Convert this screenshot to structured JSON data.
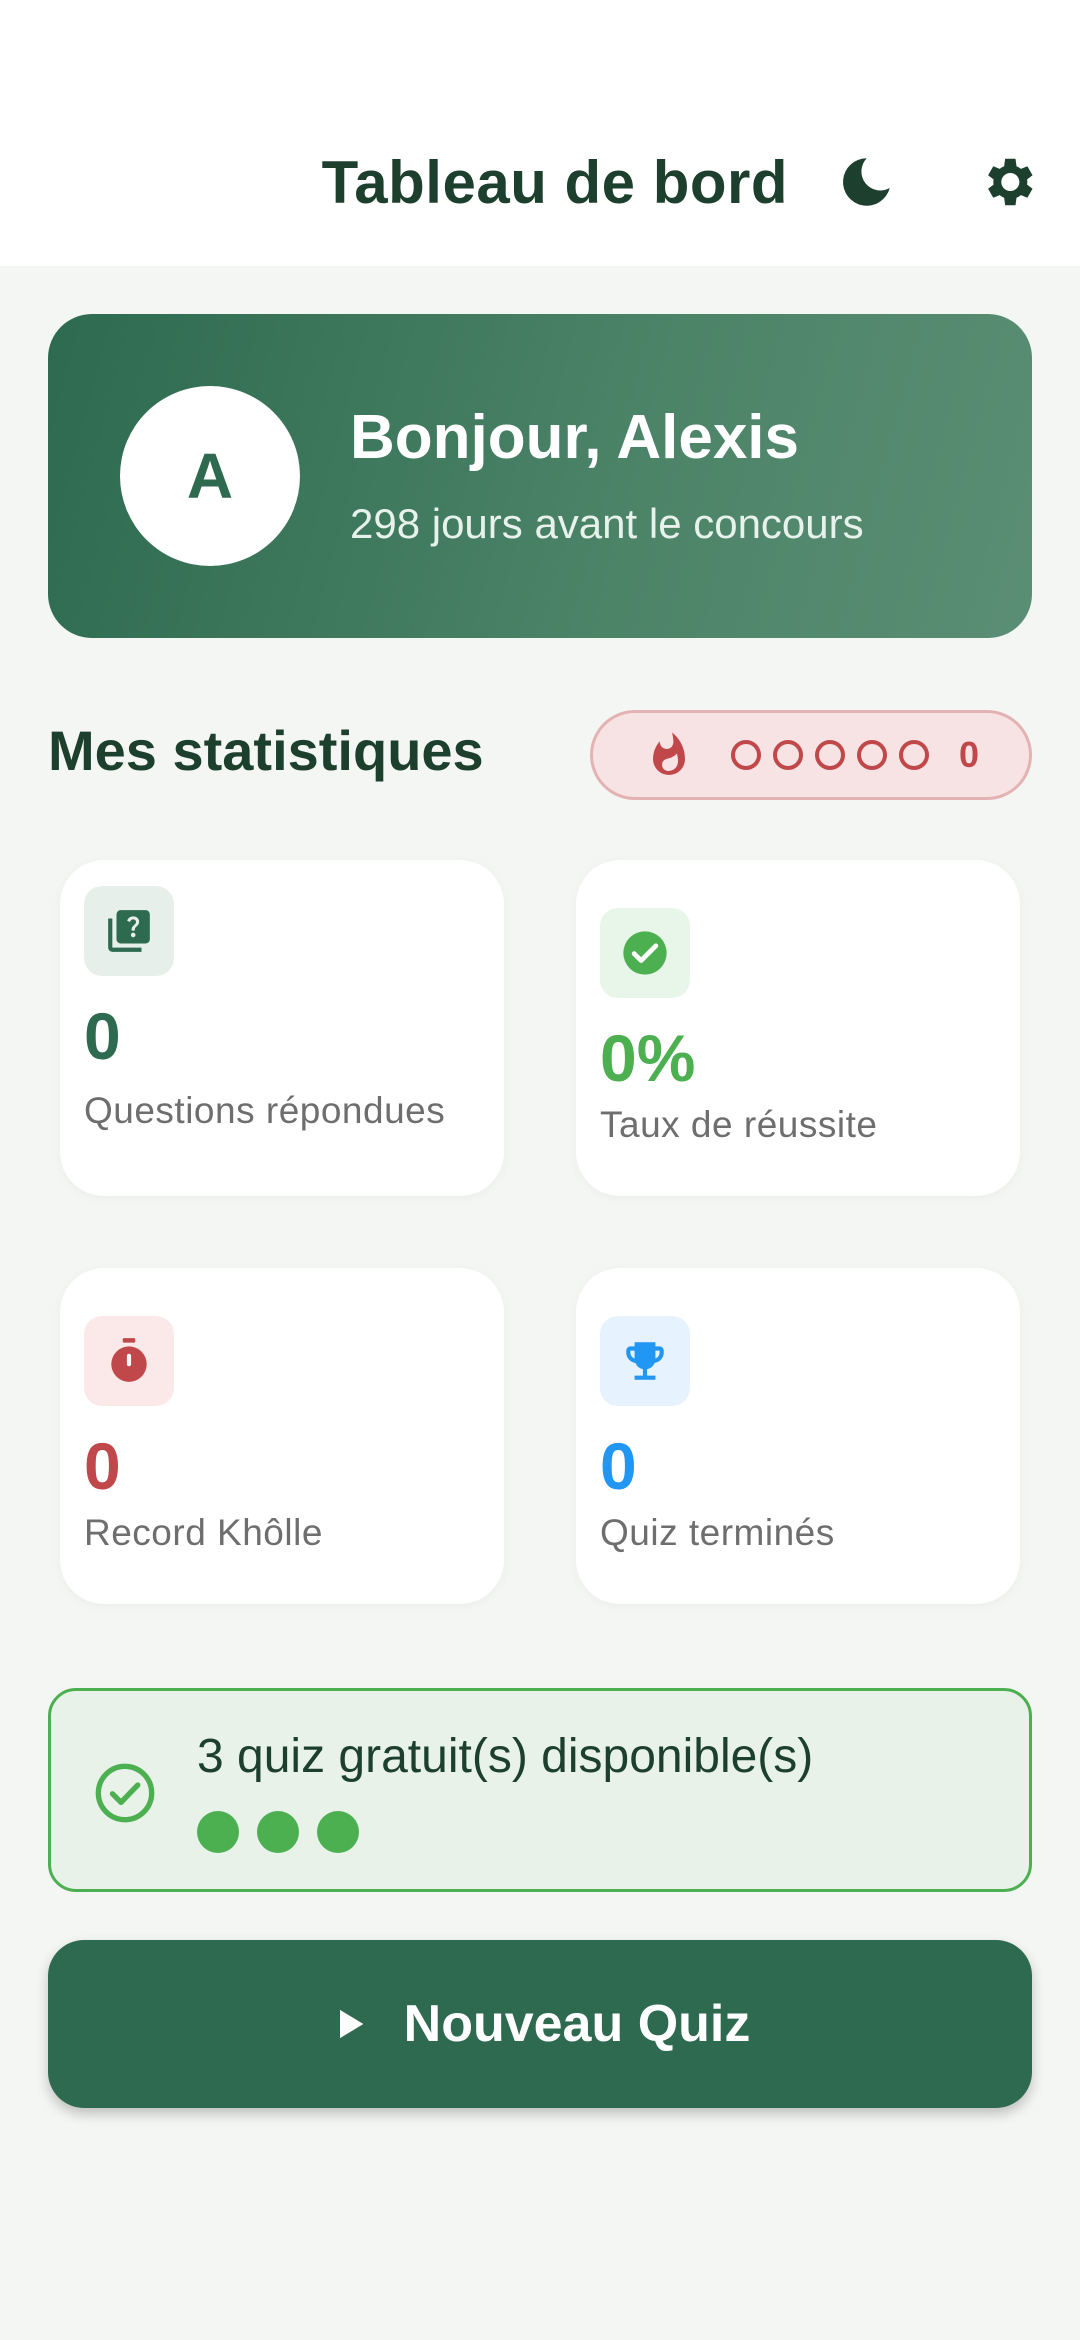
{
  "header": {
    "title": "Tableau de bord",
    "theme_icon": "moon-icon",
    "settings_icon": "gear-icon"
  },
  "welcome": {
    "avatar_initial": "A",
    "greeting": "Bonjour, Alexis",
    "countdown": "298 jours avant le concours"
  },
  "stats": {
    "section_title": "Mes statistiques",
    "streak": {
      "icon": "flame-icon",
      "count": "0",
      "dots_filled": 0,
      "dots_total": 5
    },
    "cards": [
      {
        "value": "0",
        "label": "Questions répondues",
        "icon": "quiz-icon",
        "color": "#2d6a4f"
      },
      {
        "value": "0%",
        "label": "Taux de réussite",
        "icon": "check-circle-icon",
        "color": "#4caf50"
      },
      {
        "value": "0",
        "label": "Record Khôlle",
        "icon": "timer-icon",
        "color": "#c0484a"
      },
      {
        "value": "0",
        "label": "Quiz terminés",
        "icon": "trophy-icon",
        "color": "#2196f3"
      }
    ]
  },
  "free_quiz": {
    "text": "3 quiz gratuit(s) disponible(s)",
    "available": 3,
    "icon": "check-circle-outline-icon"
  },
  "cta": {
    "label": "Nouveau Quiz",
    "icon": "play-icon"
  },
  "colors": {
    "primary": "#2d6a4f",
    "success": "#4caf50",
    "danger": "#c0484a",
    "info": "#2196f3",
    "background": "#f4f6f4"
  }
}
